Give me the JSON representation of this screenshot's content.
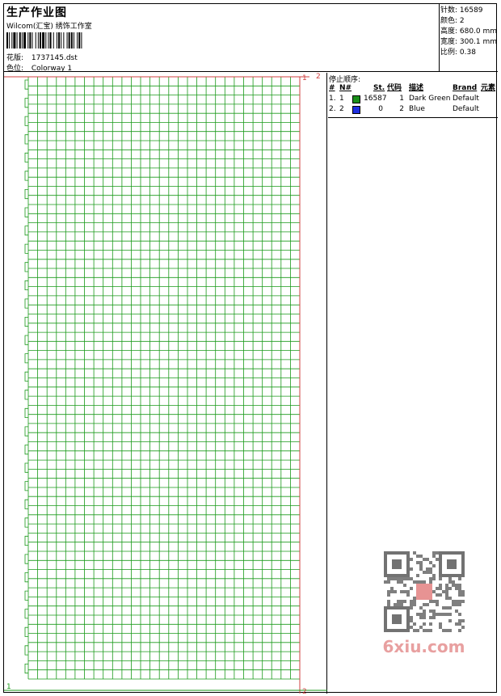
{
  "header": {
    "title": "生产作业图",
    "company": "Wilcom(汇宝) 绣饰工作室",
    "pattern_label": "花版:",
    "pattern_value": "1737145.dst",
    "colorway_label": "色位:",
    "colorway_value": "Colorway 1"
  },
  "info": {
    "stitches": "针数: 16589",
    "colors": "颜色: 2",
    "height": "高度: 680.0 mm",
    "width": "宽度: 300.1 mm",
    "scale": "比例: 0.38"
  },
  "design_markers": {
    "top_start": "1",
    "top_end": "2",
    "bottom_start": "1",
    "bottom_end": "2"
  },
  "stop_sequence": {
    "title": "停止顺序:",
    "headers": [
      "#",
      "N#",
      "St.",
      "代码",
      "描述",
      "Brand",
      "元素"
    ],
    "rows": [
      {
        "idx": "1.",
        "n": "1",
        "color": "#1a8f1a",
        "stitches": "16587",
        "code": "1",
        "desc": "Dark Green",
        "brand": "Default"
      },
      {
        "idx": "2.",
        "n": "2",
        "color": "#1e2fe0",
        "stitches": "0",
        "code": "2",
        "desc": "Blue",
        "brand": "Default"
      }
    ]
  },
  "watermark": {
    "text": "6xiu.com"
  },
  "colors": {
    "grid_green": "#1a9a1a",
    "frame_red": "#d04040"
  }
}
